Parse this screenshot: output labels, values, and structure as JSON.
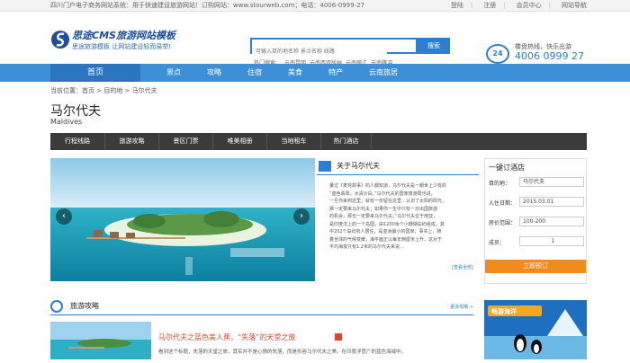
{
  "topbar": {
    "notice": "四川门户电子商务网站系统：用于快速建设旅游网站！订购网站：www.stourweb.com；电话：4006-0999-27",
    "links": [
      "登陆",
      "注册",
      "会员中心",
      "网站导航"
    ]
  },
  "header": {
    "brand_title": "思途CMS旅游网站模板",
    "brand_slogan": "思途旅游模板  让网站建设轻而易举!",
    "search_placeholder": "可输入目的地名称 景点名称 线路",
    "search_button": "搜索",
    "hot_label": "热门搜索：",
    "hot_terms": [
      "云南昆明",
      "云南西双版纳",
      "云南丽江",
      "云南腾冲"
    ],
    "service_badge": "24",
    "service_line": "楼盘热线，快乐出游",
    "service_phone": "4006  0999 27"
  },
  "nav": {
    "home": "首页",
    "items": [
      "景点",
      "攻略",
      "住宿",
      "美食",
      "特产",
      "云南旅居"
    ]
  },
  "breadcrumb": "当前位置：首页 > 目的地 > 马尔代夫",
  "destination": {
    "name": "马尔代夫",
    "english": "Maldives"
  },
  "subnav": [
    "行程线路",
    "旅游攻略",
    "景区门票",
    "唯美相册",
    "当地租车",
    "热门酒店"
  ],
  "about": {
    "title": "关于马尔代夫",
    "lines": [
      "董过《麦芫故事》的人都知道，马尔代夫是一朝世上少有的",
      "“蓝色翡翠，水清沙白。”马尔代夫的国家旅游局也说，",
      "一旦你来到这里，就有一份留在这里…认识了太阳的阳光，",
      "那一定要来马尔代夫；如果你一生中只有一次出国旅游",
      "的机会，那也一定要来马尔代夫。”马尔代夫位于南亚，",
      "是印度洋上的一个岛国，由1200余个小珊瑚岛屿组成，其",
      "中202个岛屿有人居住，是亚洲最小的国家，事实上，随",
      "着全球的气候变暖，海平面正以每年两厘米上升，这对于",
      "平均海拔只有1.2米的马尔代夫来说…"
    ],
    "more": "[查看全部]"
  },
  "booking": {
    "title": "一键订酒店",
    "city_label": "目的地：",
    "city_value": "马尔代夫",
    "checkin_label": "入住日期：",
    "checkin_value": "2015.03.01",
    "price_label": "房价范围：",
    "price_value": "100-200",
    "rooms_label": "成员：",
    "rooms_value": "1",
    "submit": "立即预订"
  },
  "tours": {
    "title": "旅游攻略",
    "more": "更多攻略 >"
  },
  "article": {
    "title": "马尔代夫之蓝色美人蕉，“失落”的天堂之旅",
    "desc": "看到这个标题，失落的天堂之旅，其实并不是心情的失落，而是形容马尔代夫之美。在印度洋宽广的蓝色海域中。"
  },
  "ad": {
    "text": "畅游海洋"
  },
  "colors": {
    "nav_blue": "#3d8fd8",
    "dark_subnav": "#3b3b3b",
    "accent_orange": "#f28a1c",
    "title_red": "#e0452b"
  }
}
